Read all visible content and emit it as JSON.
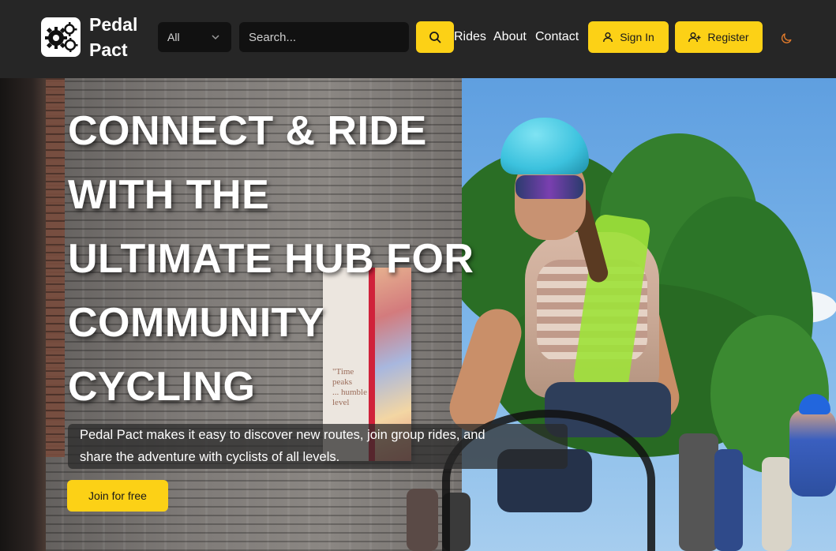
{
  "header": {
    "brand_line1": "Pedal",
    "brand_line2": "Pact",
    "logo_icon": "gears-icon",
    "category_select": {
      "value": "All",
      "icon": "chevron-down-icon"
    },
    "search": {
      "placeholder": "Search...",
      "value": "",
      "button_icon": "search-icon"
    },
    "nav": [
      "Rides",
      "About",
      "Contact"
    ],
    "sign_in": {
      "label": "Sign In",
      "icon": "user-icon"
    },
    "register": {
      "label": "Register",
      "icon": "user-plus-icon"
    },
    "theme_toggle_icon": "moon-icon"
  },
  "hero": {
    "title_lines": [
      "CONNECT & RIDE",
      "WITH THE",
      "ULTIMATE HUB FOR",
      "COMMUNITY",
      "CYCLING"
    ],
    "subtitle_line1": "Pedal Pact makes it easy to discover new routes, join group rides, and",
    "subtitle_line2": "share the adventure with cyclists of all levels.",
    "cta_label": "Join for free",
    "poster_text": [
      "\"Time",
      "peaks",
      "... humble",
      "level"
    ]
  },
  "colors": {
    "accent": "#fcd116",
    "header_bg": "#262626",
    "input_bg": "#111111",
    "moon": "#e07a2b"
  }
}
